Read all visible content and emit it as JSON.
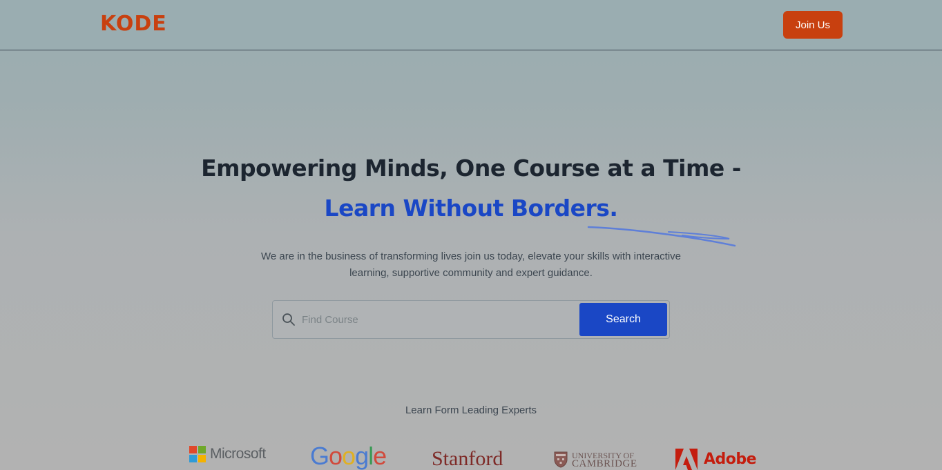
{
  "header": {
    "logo": "KODE",
    "join_label": "Join Us"
  },
  "hero": {
    "line1": "Empowering Minds, One Course at a Time -",
    "line2": "Learn Without Borders.",
    "subtext": "We are in the business of transforming lives join us today, elevate your skills with interactive learning, supportive community and expert guidance."
  },
  "search": {
    "placeholder": "Find Course",
    "value": "",
    "button_label": "Search"
  },
  "experts": {
    "label": "Learn Form Leading Experts",
    "partners": {
      "microsoft": "Microsoft",
      "google": [
        "G",
        "o",
        "o",
        "g",
        "l",
        "e"
      ],
      "stanford": "Stanford",
      "cambridge_line1": "UNIVERSITY OF",
      "cambridge_line2": "CAMBRIDGE",
      "adobe": "Adobe"
    }
  },
  "colors": {
    "brand": "#c8400f",
    "accent": "#1a47c5",
    "google": [
      "#4a7bd1",
      "#d14a3c",
      "#e0b023",
      "#4a7bd1",
      "#3a9a55",
      "#d14a3c"
    ],
    "microsoft": [
      "#e0482b",
      "#6fa82a",
      "#2f9bd6",
      "#f4b200"
    ]
  },
  "icons": {
    "search": "search-icon",
    "underline": "scribble-underline-icon"
  }
}
